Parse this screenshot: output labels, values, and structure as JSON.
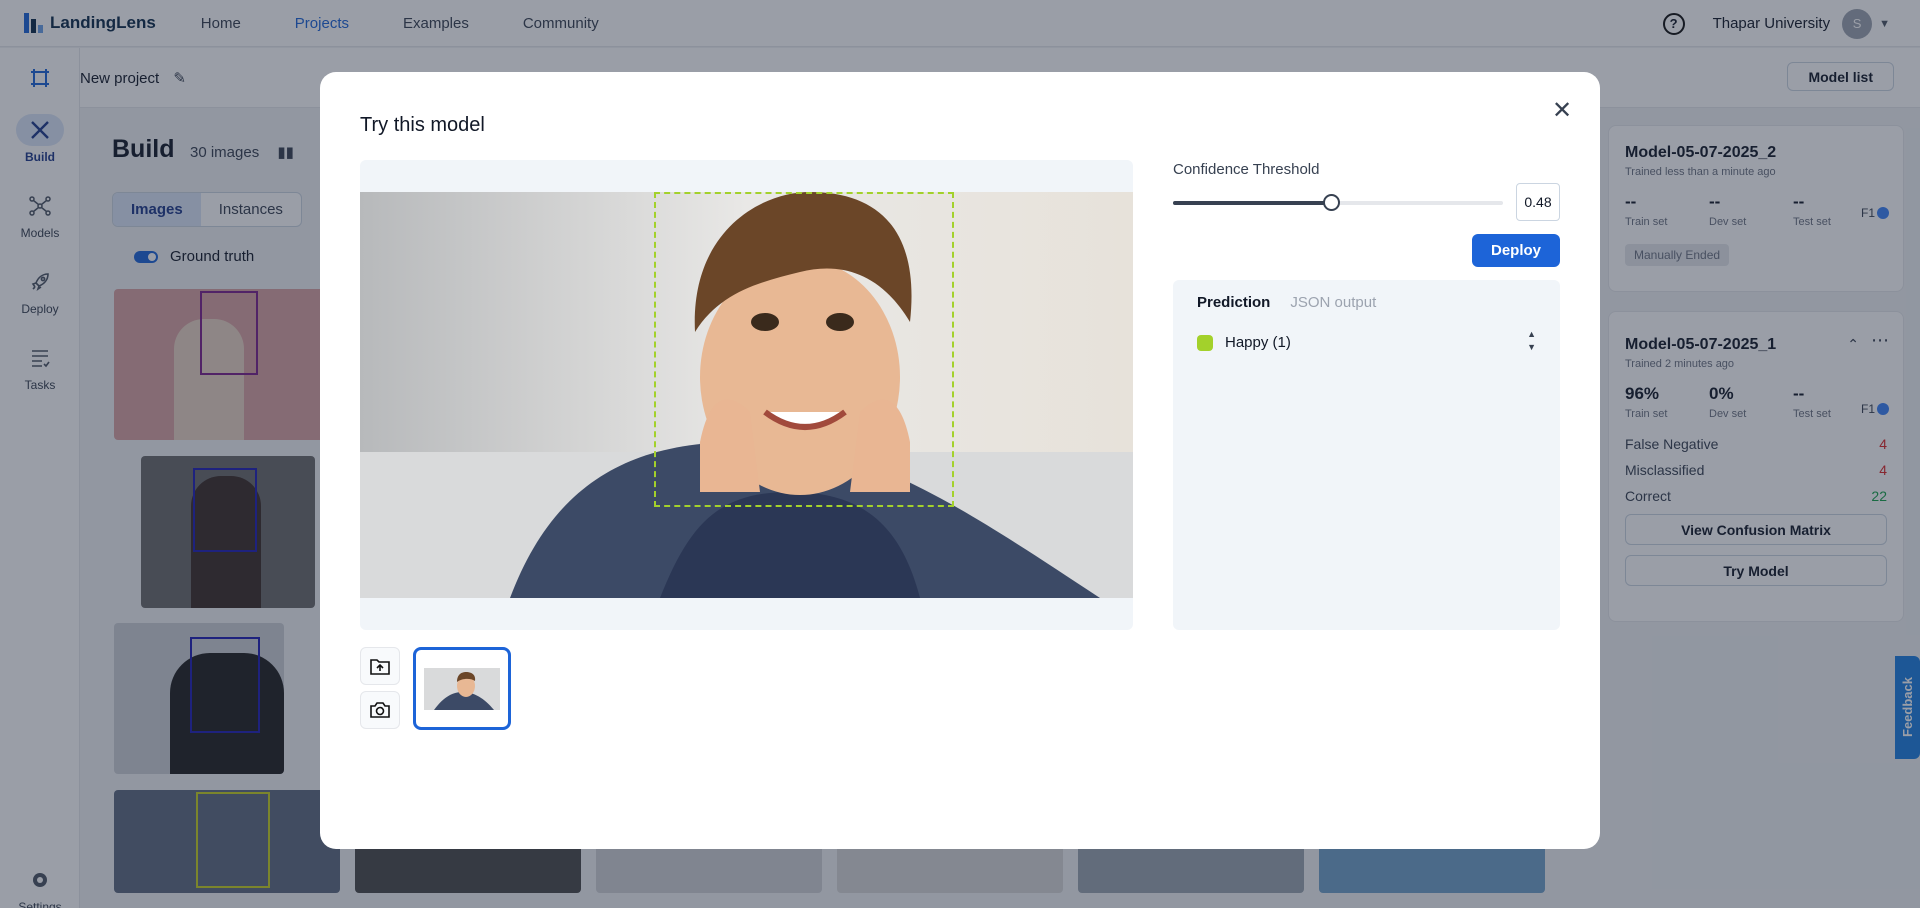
{
  "app": {
    "name": "LandingLens"
  },
  "nav": {
    "home": "Home",
    "projects": "Projects",
    "examples": "Examples",
    "community": "Community"
  },
  "user": {
    "org": "Thapar University",
    "initial": "S"
  },
  "sidenav": {
    "build": "Build",
    "models": "Models",
    "deploy": "Deploy",
    "tasks": "Tasks",
    "settings": "Settings"
  },
  "project": {
    "name": "New project",
    "model_list": "Model list"
  },
  "build": {
    "title": "Build",
    "count": "30 images",
    "tab_images": "Images",
    "tab_instances": "Instances",
    "ground_truth": "Ground truth"
  },
  "models": [
    {
      "name": "Model-05-07-2025_2",
      "trained": "Trained less than a minute ago",
      "train": "--",
      "dev": "--",
      "test": "--",
      "train_label": "Train set",
      "dev_label": "Dev set",
      "test_label": "Test set",
      "f1": "F1",
      "status": "Manually Ended"
    },
    {
      "name": "Model-05-07-2025_1",
      "trained": "Trained 2 minutes ago",
      "train": "96%",
      "dev": "0%",
      "test": "--",
      "train_label": "Train set",
      "dev_label": "Dev set",
      "test_label": "Test set",
      "f1": "F1",
      "false_negative_label": "False Negative",
      "false_negative": "4",
      "misclassified_label": "Misclassified",
      "misclassified": "4",
      "correct_label": "Correct",
      "correct": "22",
      "confusion_btn": "View Confusion Matrix",
      "try_btn": "Try Model"
    }
  ],
  "feedback": "Feedback",
  "modal": {
    "title": "Try this model",
    "confidence_label": "Confidence Threshold",
    "threshold": "0.48",
    "threshold_value": 0.48,
    "deploy": "Deploy",
    "tab_prediction": "Prediction",
    "tab_json": "JSON output",
    "prediction_label": "Happy (1)",
    "prediction_color": "#a3d12b"
  },
  "colors": {
    "accent": "#1d64d8",
    "happy": "#a3d12b",
    "angry": "#1e1eb4",
    "surprise": "#7b1f8a",
    "danger": "#dc2626",
    "success": "#16a34a"
  }
}
